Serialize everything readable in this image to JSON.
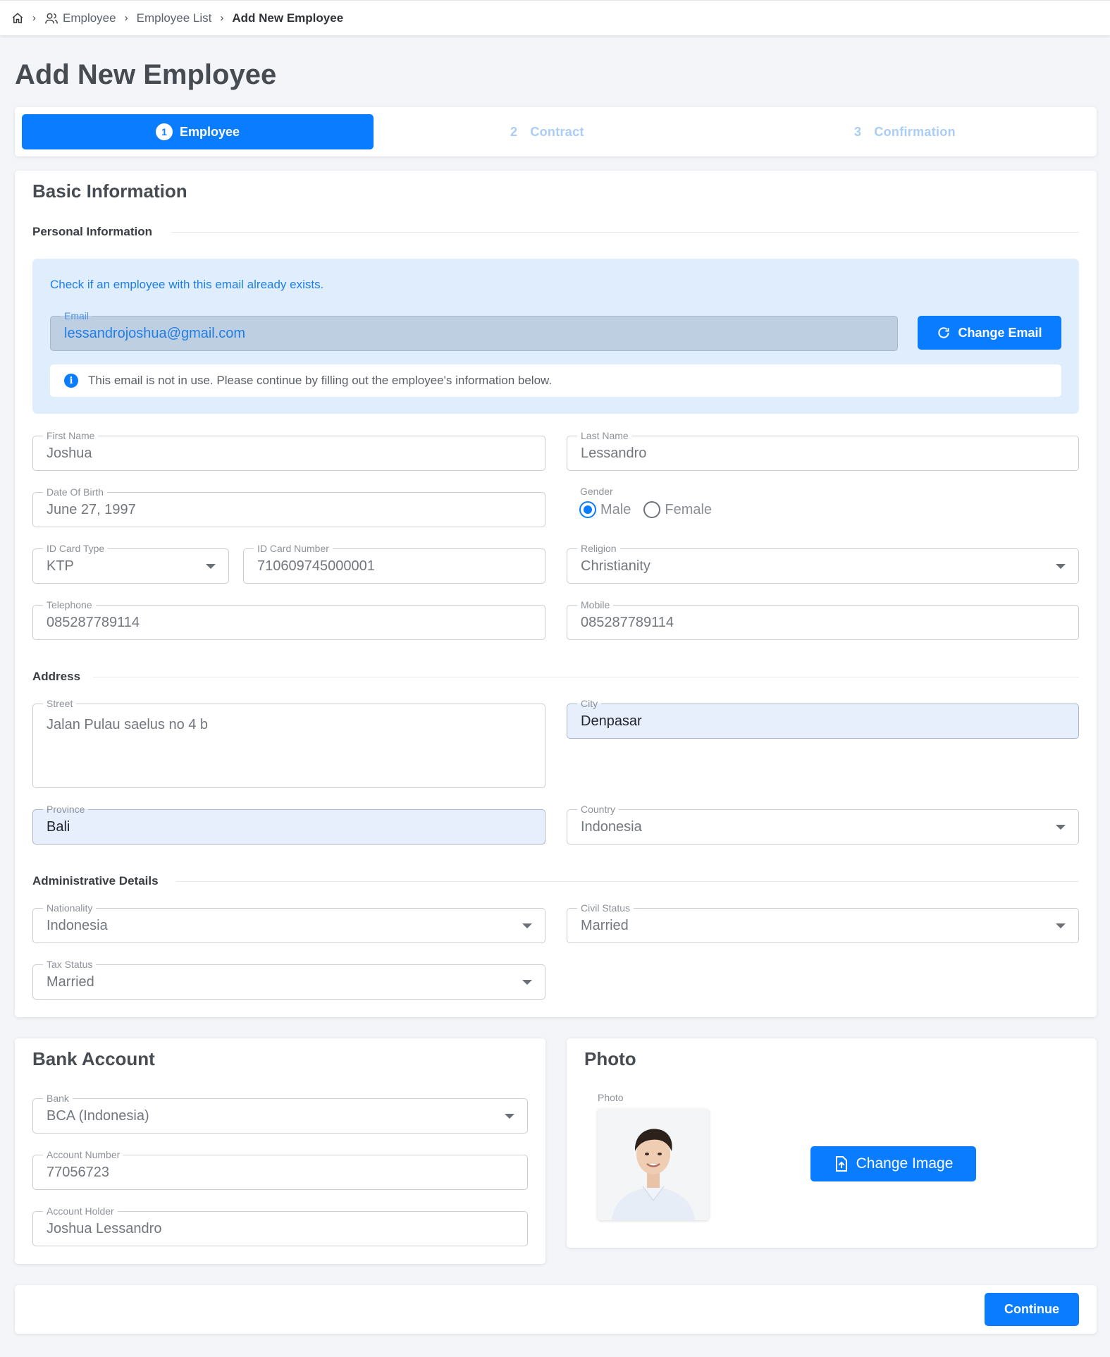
{
  "breadcrumb": {
    "home_icon": "home-icon",
    "employee_icon": "users-icon",
    "items": [
      "Employee",
      "Employee List",
      "Add New Employee"
    ]
  },
  "page": {
    "title": "Add New Employee"
  },
  "stepper": {
    "steps": [
      {
        "number": "1",
        "label": "Employee",
        "active": true
      },
      {
        "number": "2",
        "label": "Contract",
        "active": false
      },
      {
        "number": "3",
        "label": "Confirmation",
        "active": false
      }
    ]
  },
  "basic_info": {
    "title": "Basic Information",
    "personal_section": "Personal Information",
    "email_check": {
      "hint": "Check if an employee with this email already exists.",
      "email_label": "Email",
      "email_value": "lessandrojoshua@gmail.com",
      "change_email_label": "Change Email",
      "note": "This email is not in use. Please continue by filling out the employee's information below."
    },
    "first_name": {
      "label": "First Name",
      "value": "Joshua"
    },
    "last_name": {
      "label": "Last Name",
      "value": "Lessandro"
    },
    "dob": {
      "label": "Date Of Birth",
      "value": "June 27, 1997"
    },
    "gender": {
      "label": "Gender",
      "options": [
        "Male",
        "Female"
      ],
      "selected": "Male"
    },
    "id_card_type": {
      "label": "ID Card Type",
      "value": "KTP"
    },
    "id_card_number": {
      "label": "ID Card Number",
      "value": "710609745000001"
    },
    "religion": {
      "label": "Religion",
      "value": "Christianity"
    },
    "telephone": {
      "label": "Telephone",
      "value": "085287789114"
    },
    "mobile": {
      "label": "Mobile",
      "value": "085287789114"
    },
    "address_section": "Address",
    "street": {
      "label": "Street",
      "value": "Jalan Pulau saelus no 4 b"
    },
    "city": {
      "label": "City",
      "value": "Denpasar"
    },
    "province": {
      "label": "Province",
      "value": "Bali"
    },
    "country": {
      "label": "Country",
      "value": "Indonesia"
    },
    "admin_section": "Administrative Details",
    "nationality": {
      "label": "Nationality",
      "value": "Indonesia"
    },
    "civil_status": {
      "label": "Civil Status",
      "value": "Married"
    },
    "tax_status": {
      "label": "Tax Status",
      "value": "Married"
    }
  },
  "bank_account": {
    "title": "Bank Account",
    "bank": {
      "label": "Bank",
      "value": "BCA (Indonesia)"
    },
    "account_number": {
      "label": "Account Number",
      "value": "77056723"
    },
    "account_holder": {
      "label": "Account Holder",
      "value": "Joshua Lessandro"
    }
  },
  "photo": {
    "title": "Photo",
    "label": "Photo",
    "change_image_label": "Change Image"
  },
  "footer": {
    "continue_label": "Continue"
  },
  "colors": {
    "primary": "#0a7cff",
    "panel": "#dfedfd",
    "autofill": "#e7eefc"
  }
}
